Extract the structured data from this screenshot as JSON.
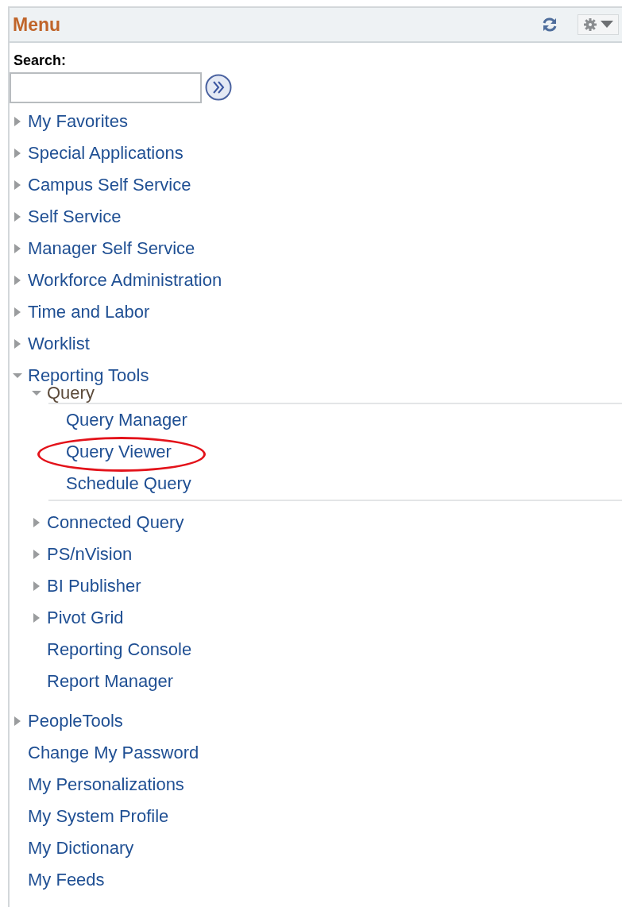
{
  "panel": {
    "title": "Menu"
  },
  "search": {
    "label": "Search:"
  },
  "menu": [
    {
      "label": "My Favorites",
      "kind": "folder",
      "expanded": false
    },
    {
      "label": "Special Applications",
      "kind": "folder",
      "expanded": false
    },
    {
      "label": "Campus Self Service",
      "kind": "folder",
      "expanded": false
    },
    {
      "label": "Self Service",
      "kind": "folder",
      "expanded": false
    },
    {
      "label": "Manager Self Service",
      "kind": "folder",
      "expanded": false
    },
    {
      "label": "Workforce Administration",
      "kind": "folder",
      "expanded": false
    },
    {
      "label": "Time and Labor",
      "kind": "folder",
      "expanded": false
    },
    {
      "label": "Worklist",
      "kind": "folder",
      "expanded": false
    },
    {
      "label": "Reporting Tools",
      "kind": "folder",
      "expanded": true,
      "children": [
        {
          "label": "Query",
          "kind": "folder",
          "expanded": true,
          "children": [
            {
              "label": "Query Manager",
              "kind": "link",
              "highlighted": false
            },
            {
              "label": "Query Viewer",
              "kind": "link",
              "highlighted": true
            },
            {
              "label": "Schedule Query",
              "kind": "link",
              "highlighted": false
            }
          ]
        },
        {
          "label": "Connected Query",
          "kind": "folder",
          "expanded": false
        },
        {
          "label": "PS/nVision",
          "kind": "folder",
          "expanded": false
        },
        {
          "label": "BI Publisher",
          "kind": "folder",
          "expanded": false
        },
        {
          "label": "Pivot Grid",
          "kind": "folder",
          "expanded": false
        },
        {
          "label": "Reporting Console",
          "kind": "link",
          "highlighted": false
        },
        {
          "label": "Report Manager",
          "kind": "link",
          "highlighted": false
        }
      ]
    },
    {
      "label": "PeopleTools",
      "kind": "folder",
      "expanded": false
    },
    {
      "label": "Change My Password",
      "kind": "link",
      "highlighted": false
    },
    {
      "label": "My Personalizations",
      "kind": "link",
      "highlighted": false
    },
    {
      "label": "My System Profile",
      "kind": "link",
      "highlighted": false
    },
    {
      "label": "My Dictionary",
      "kind": "link",
      "highlighted": false
    },
    {
      "label": "My Feeds",
      "kind": "link",
      "highlighted": false
    }
  ]
}
